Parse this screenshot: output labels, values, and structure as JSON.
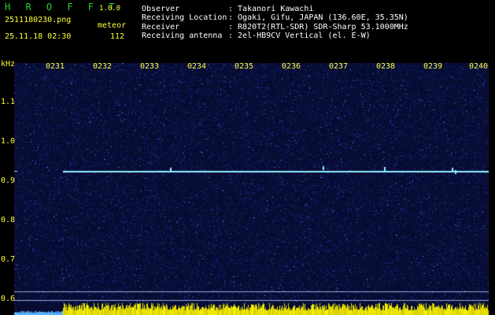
{
  "app": {
    "name": "H R O F F T",
    "version": "1.0.0"
  },
  "file": {
    "name": "2511180230.png",
    "datetime": "25.11.18 02:30"
  },
  "meteor": {
    "label": "meteor",
    "count": "112"
  },
  "info": [
    {
      "key": "Observer",
      "value": ": Takanori Kawachi"
    },
    {
      "key": "Receiving Location",
      "value": ": Ogaki, Gifu, JAPAN (136.60E, 35.35N)"
    },
    {
      "key": "Receiver",
      "value": ": R820T2(RTL-SDR) SDR-Sharp 53.1000MHz"
    },
    {
      "key": "Receiving antenna",
      "value": ": 2el-HB9CV Vertical (el. E-W)"
    }
  ],
  "axis": {
    "y_unit": "kHz",
    "y_ticks": [
      "1.1",
      "1.0",
      "0.9",
      "0.8",
      "0.7",
      "0.6"
    ],
    "x_ticks": [
      "0231",
      "0232",
      "0233",
      "0234",
      "0235",
      "0236",
      "0237",
      "0238",
      "0239",
      "0240"
    ]
  },
  "colors": {
    "background": "#000000",
    "plot": "#070c33",
    "noise": "#2f44c8",
    "carrier": "#8ff0ff",
    "header_green": "#2bd02b",
    "header_yellow": "#ffff3a",
    "bottom_bars": "#f4f000",
    "base_line": "#5ab0ff"
  }
}
